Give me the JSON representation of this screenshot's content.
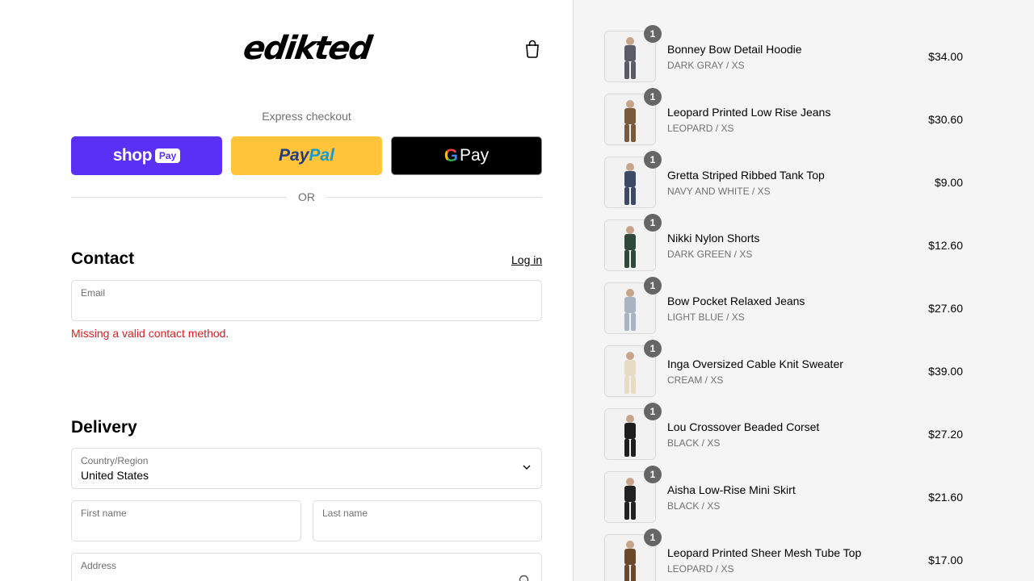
{
  "brand": {
    "logo_text": "edikted"
  },
  "express": {
    "label": "Express checkout",
    "shop_pay": {
      "word": "shop",
      "pill": "Pay"
    },
    "paypal": {
      "part1": "Pay",
      "part2": "Pal"
    },
    "google_pay": {
      "g": "G",
      "word": "Pay"
    }
  },
  "divider": {
    "text": "OR"
  },
  "contact": {
    "title": "Contact",
    "login_label": "Log in",
    "email_label": "Email",
    "email_value": "",
    "error": "Missing a valid contact method."
  },
  "delivery": {
    "title": "Delivery",
    "country_label": "Country/Region",
    "country_value": "United States",
    "first_name_label": "First name",
    "last_name_label": "Last name",
    "address_label": "Address"
  },
  "order_items": [
    {
      "qty": "1",
      "name": "Bonney Bow Detail Hoodie",
      "variant": "DARK GRAY / XS",
      "price": "$34.00",
      "tone": "#5a5d66"
    },
    {
      "qty": "1",
      "name": "Leopard Printed Low Rise Jeans",
      "variant": "LEOPARD / XS",
      "price": "$30.60",
      "tone": "#7a5a3c"
    },
    {
      "qty": "1",
      "name": "Gretta Striped Ribbed Tank Top",
      "variant": "NAVY AND WHITE / XS",
      "price": "$9.00",
      "tone": "#3d4a66"
    },
    {
      "qty": "1",
      "name": "Nikki Nylon Shorts",
      "variant": "DARK GREEN / XS",
      "price": "$12.60",
      "tone": "#2f4a3a"
    },
    {
      "qty": "1",
      "name": "Bow Pocket Relaxed Jeans",
      "variant": "LIGHT BLUE / XS",
      "price": "$27.60",
      "tone": "#a9b4c2"
    },
    {
      "qty": "1",
      "name": "Inga Oversized Cable Knit Sweater",
      "variant": "CREAM / XS",
      "price": "$39.00",
      "tone": "#e6dcc4"
    },
    {
      "qty": "1",
      "name": "Lou Crossover Beaded Corset",
      "variant": "BLACK / XS",
      "price": "$27.20",
      "tone": "#1e1e1e"
    },
    {
      "qty": "1",
      "name": "Aisha Low-Rise Mini Skirt",
      "variant": "BLACK / XS",
      "price": "$21.60",
      "tone": "#222222"
    },
    {
      "qty": "1",
      "name": "Leopard Printed Sheer Mesh Tube Top",
      "variant": "LEOPARD / XS",
      "price": "$17.00",
      "tone": "#6b4a2c"
    }
  ],
  "colors": {
    "accent": "#5a31f4",
    "error": "#dd1d1d",
    "paypal": "#ffc439"
  }
}
